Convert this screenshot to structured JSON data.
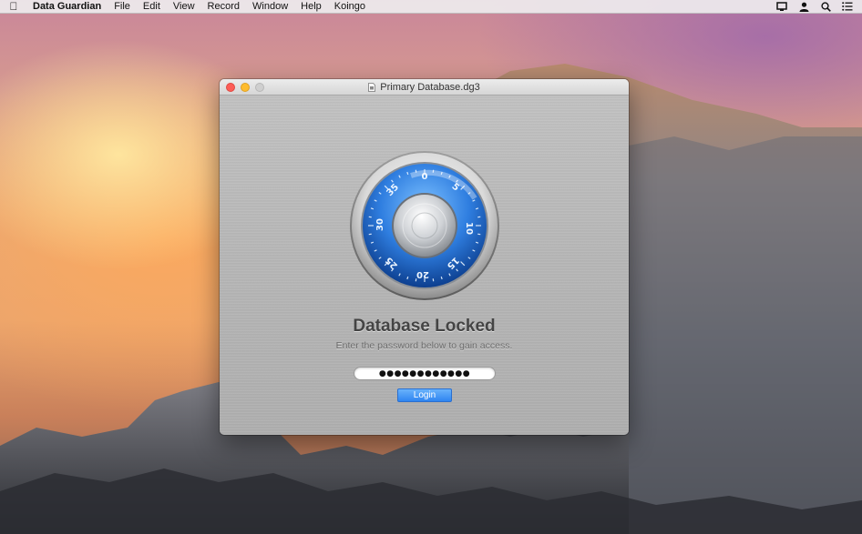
{
  "menubar": {
    "app_name": "Data Guardian",
    "items": [
      "File",
      "Edit",
      "View",
      "Record",
      "Window",
      "Help",
      "Koingo"
    ],
    "status_icons": [
      "display-icon",
      "user-icon",
      "spotlight-search-icon",
      "notification-center-icon"
    ]
  },
  "window": {
    "title": "Primary Database.dg3",
    "traffic_lights": {
      "close_color": "#fd5d57",
      "minimize_color": "#febc2e",
      "zoom_color": "#cfcfcf"
    }
  },
  "dial": {
    "numbers": [
      "0",
      "5",
      "10",
      "15",
      "20",
      "25",
      "30",
      "35"
    ],
    "ring_color": "#2f7ee0"
  },
  "lock_screen": {
    "heading": "Database Locked",
    "subtitle": "Enter the password below to gain access.",
    "password_value": "●●●●●●●●●●●●",
    "login_label": "Login"
  }
}
